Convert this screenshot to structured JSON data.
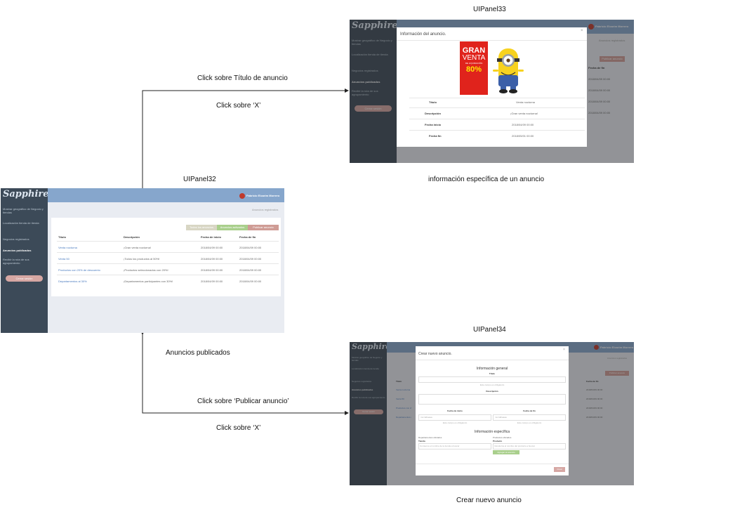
{
  "panels": {
    "p33": {
      "caption": "UIPanel33",
      "subtitle": "información específica de un anuncio"
    },
    "p32": {
      "caption": "UIPanel32",
      "subtitle": "Anuncios publicados"
    },
    "p34": {
      "caption": "UIPanel34",
      "subtitle": "Crear nuevo anuncio"
    }
  },
  "edges": {
    "to33_a": "Click sobre Título de anuncio",
    "to33_b": "Click sobre ‘X’",
    "to34_a": "Click sobre ‘Publicar anuncio’",
    "to34_b": "Click sobre ‘X’"
  },
  "app": {
    "logo": "Sapphire",
    "user": "Fabricio Elcarim Morrero",
    "nav": [
      {
        "label": "Mostrar geográfico de Negocio y tiendas"
      },
      {
        "label": "Localización tienda de tienda"
      },
      {
        "label": "Negocios registrados"
      },
      {
        "label": "Anuncios publicados"
      },
      {
        "label": "Recibir la ruta de sus agrupamiento"
      }
    ],
    "logout": "Cerrar sesión",
    "breadcrumb": "Anuncios registrados"
  },
  "list": {
    "buttons": [
      "Todos los anuncios",
      "Anuncios activados",
      "Publicar anuncio"
    ],
    "columns": [
      "Título",
      "Descripción",
      "Fecha de inicio",
      "Fecha de fin"
    ],
    "rows": [
      [
        "Venta nocturna",
        "¡Gran venta nocturna!",
        "2018/04/09 00:00",
        "2018/04/09 00:00"
      ],
      [
        "Venta 50",
        "¡Todos los productos al 50%!",
        "2018/04/09 00:00",
        "2018/04/09 00:00"
      ],
      [
        "Productos con 20% de descuento",
        "¡Productos seleccionados con 20%!",
        "2018/04/09 00:00",
        "2018/04/09 00:00"
      ],
      [
        "Departamentos al 30%",
        "¡Departamentos participantes con 30%!",
        "2018/04/09 00:00",
        "2018/04/09 00:00"
      ]
    ]
  },
  "info_modal": {
    "title": "Información del anuncio.",
    "poster": {
      "line1": "GRAN",
      "line2": "VENTA",
      "line3": "DE LIQUIDACIÓN",
      "percent": "80%"
    },
    "fields": [
      {
        "label": "Título",
        "value": "Venta nocturna"
      },
      {
        "label": "Descripción",
        "value": "¡Gran venta nocturna!"
      },
      {
        "label": "Fecha inicio",
        "value": "2018/04/09 00:00"
      },
      {
        "label": "Fecha fin",
        "value": "2018/05/01 00:00"
      }
    ]
  },
  "create_modal": {
    "title": "Crear nuevo anuncio.",
    "general": "Información general",
    "titulo": "Título",
    "titulo_ph": "Este campo es obligatorio",
    "descripcion": "Descripción",
    "fecha_inicio": "Fecha de inicio",
    "fecha_fin": "Fecha de fin",
    "date_ph": "mm/dd/aaaa",
    "date_hint": "Este campo es obligatorio",
    "especifica": "Información específica",
    "dept_label": "Departamentos ubicados",
    "prod_label": "Productos ubicados",
    "tienda": "Tienda",
    "producto": "Producto",
    "tienda_ph": "Comience el nombre de la tienda a buscar",
    "prod_ph": "Introduzca el nombre del producto a buscar",
    "add_btn": "Agregar al anuncio",
    "submit": "Crear"
  }
}
